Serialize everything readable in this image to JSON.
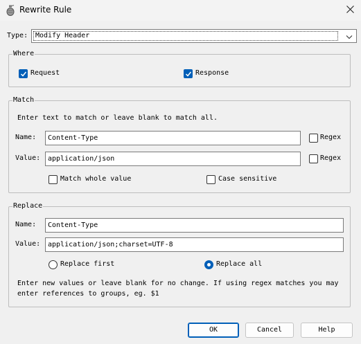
{
  "window": {
    "title": "Rewrite Rule",
    "close_icon": "close-icon",
    "app_icon": "grenade-icon"
  },
  "type_field": {
    "label": "Type:",
    "value": "Modify Header"
  },
  "where": {
    "legend": "Where",
    "request": {
      "label": "Request",
      "checked": true
    },
    "response": {
      "label": "Response",
      "checked": true
    }
  },
  "match": {
    "legend": "Match",
    "instructions": "Enter text to match or leave blank to match all.",
    "name": {
      "label": "Name:",
      "value": "Content-Type",
      "regex_label": "Regex",
      "regex_checked": false
    },
    "value": {
      "label": "Value:",
      "value": "application/json",
      "regex_label": "Regex",
      "regex_checked": false
    },
    "match_whole_value": {
      "label": "Match whole value",
      "checked": false
    },
    "case_sensitive": {
      "label": "Case sensitive",
      "checked": false
    }
  },
  "replace": {
    "legend": "Replace",
    "name": {
      "label": "Name:",
      "value": "Content-Type"
    },
    "value": {
      "label": "Value:",
      "value": "application/json;charset=UTF-8"
    },
    "replace_first": {
      "label": "Replace first",
      "selected": false
    },
    "replace_all": {
      "label": "Replace all",
      "selected": true
    },
    "note_line1": "Enter new values or leave blank for no change. If using regex matches you may",
    "note_line2": "enter references to groups, eg. $1"
  },
  "buttons": {
    "ok": "OK",
    "cancel": "Cancel",
    "help": "Help"
  },
  "colors": {
    "accent": "#005fb8",
    "background": "#f0f0f0",
    "group_border": "#bdbdbd"
  }
}
